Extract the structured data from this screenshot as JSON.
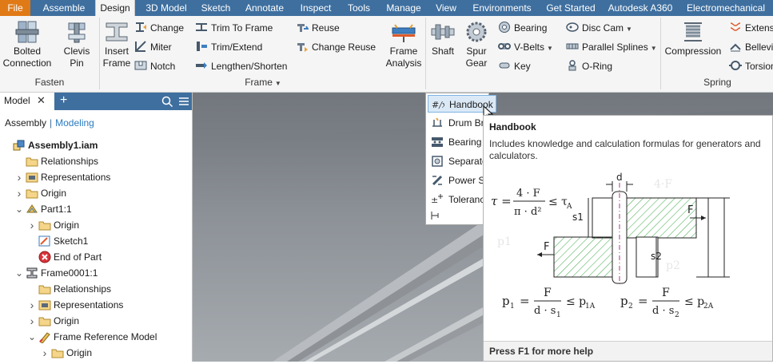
{
  "tabs": [
    "File",
    "Assemble",
    "Design",
    "3D Model",
    "Sketch",
    "Annotate",
    "Inspect",
    "Tools",
    "Manage",
    "View",
    "Environments",
    "Get Started",
    "Autodesk A360",
    "Electromechanical"
  ],
  "active_tab": "Design",
  "ribbon": {
    "fasten": {
      "panel": "Fasten",
      "bolted": "Bolted\nConnection",
      "clevis": "Clevis\nPin"
    },
    "frame": {
      "panel": "Frame",
      "insert": "Insert\nFrame",
      "change": "Change",
      "miter": "Miter",
      "notch": "Notch",
      "trim_to_frame": "Trim To Frame",
      "trim_extend": "Trim/Extend",
      "lengthen": "Lengthen/Shorten",
      "reuse": "Reuse",
      "change_reuse": "Change Reuse",
      "analysis": "Frame\nAnalysis"
    },
    "power": {
      "shaft": "Shaft",
      "spur": "Spur\nGear",
      "bearing": "Bearing",
      "vbelts": "V-Belts",
      "key": "Key",
      "disc_cam": "Disc Cam",
      "parallel_splines": "Parallel Splines",
      "oring": "O-Ring"
    },
    "spring": {
      "panel": "Spring",
      "compression": "Compression",
      "extension": "Extensi",
      "belleville": "Bellevil",
      "torsion": "Torsion"
    }
  },
  "browser": {
    "tab": "Model",
    "close": "✕",
    "add": "+",
    "views": [
      "Assembly",
      "Modeling"
    ],
    "tree": [
      {
        "label": "Assembly1.iam",
        "level": 0,
        "icon": "assembly-icon",
        "twisty": "",
        "bold": true
      },
      {
        "label": "Relationships",
        "level": 1,
        "icon": "folder-icon",
        "twisty": ""
      },
      {
        "label": "Representations",
        "level": 1,
        "icon": "representations-icon",
        "twisty": ">"
      },
      {
        "label": "Origin",
        "level": 1,
        "icon": "folder-icon",
        "twisty": ">"
      },
      {
        "label": "Part1:1",
        "level": 1,
        "icon": "part-icon",
        "twisty": "v"
      },
      {
        "label": "Origin",
        "level": 2,
        "icon": "folder-icon",
        "twisty": ">"
      },
      {
        "label": "Sketch1",
        "level": 2,
        "icon": "sketch-icon",
        "twisty": ""
      },
      {
        "label": "End of Part",
        "level": 2,
        "icon": "end-of-part-icon",
        "twisty": ""
      },
      {
        "label": "Frame0001:1",
        "level": 1,
        "icon": "frame-icon",
        "twisty": "v"
      },
      {
        "label": "Relationships",
        "level": 2,
        "icon": "folder-icon",
        "twisty": ""
      },
      {
        "label": "Representations",
        "level": 2,
        "icon": "representations-icon",
        "twisty": ">"
      },
      {
        "label": "Origin",
        "level": 2,
        "icon": "folder-icon",
        "twisty": ">"
      },
      {
        "label": "Frame Reference Model",
        "level": 2,
        "icon": "frame-reference-icon",
        "twisty": "v"
      },
      {
        "label": "Origin",
        "level": 3,
        "icon": "folder-icon",
        "twisty": ">"
      }
    ]
  },
  "dropdown": {
    "items": [
      {
        "label": "Handbook",
        "icon": "handbook-icon",
        "highlighted": true
      },
      {
        "label": "Drum Br",
        "icon": "drum-brake-icon"
      },
      {
        "label": "Bearing",
        "icon": "bearing-calc-icon"
      },
      {
        "label": "Separate",
        "icon": "separated-hub-icon"
      },
      {
        "label": "Power Sc",
        "icon": "power-screw-icon"
      },
      {
        "label": "Toleranc",
        "icon": "tolerance-icon"
      }
    ]
  },
  "tooltip": {
    "title": "Handbook",
    "description": "Includes knowledge and calculation formulas for generators and calculators.",
    "footer": "Press F1 for more help",
    "figure": {
      "tau_formula": "τ = 4·F / π·d² ≤ τA",
      "p1_formula": "p1 = F / d·s1 ≤ p1A",
      "p2_formula": "p2 = F / d·s2 ≤ p2A",
      "labels": [
        "d",
        "F",
        "F",
        "s1",
        "s2"
      ]
    }
  },
  "colors": {
    "tab_bar": "#3e6f9f",
    "file_tab": "#e07a16",
    "ribbon_bg": "#f5f5f5",
    "highlight": "#dbe9f7",
    "hatch": "#3aa845"
  }
}
